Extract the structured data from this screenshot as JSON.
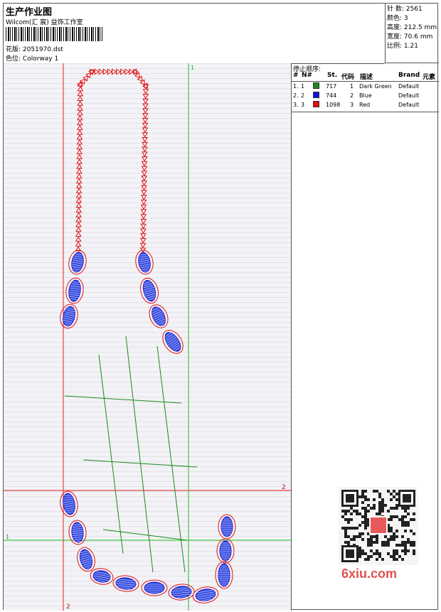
{
  "header": {
    "title": "生产作业图",
    "company": "Wilcom(汇 宸) 益饰工作室",
    "design_label": "花版:",
    "design_file": "2051970.dst",
    "colorway_label": "色位:",
    "colorway": "Colorway 1"
  },
  "stats": [
    {
      "label": "针 数:",
      "value": "2561"
    },
    {
      "label": "颜色:",
      "value": "3"
    },
    {
      "label": "高度:",
      "value": "212.5 mm"
    },
    {
      "label": "宽度:",
      "value": "70.6 mm"
    },
    {
      "label": "比例:",
      "value": "1.21"
    }
  ],
  "guides": {
    "v1": "1",
    "h2": "2",
    "h1": "1",
    "v2": "2"
  },
  "stop_sequence": {
    "title": "停止顺序:",
    "columns": [
      "#",
      "N#",
      "St.",
      "代码",
      "描述",
      "Brand",
      "元素"
    ],
    "rows": [
      {
        "num": "1.",
        "n": "1",
        "color": "#1a8a1a",
        "stitches": "717",
        "code": "1",
        "desc": "Dark Green",
        "brand": "Default"
      },
      {
        "num": "2.",
        "n": "2",
        "color": "#1010e0",
        "stitches": "744",
        "code": "2",
        "desc": "Blue",
        "brand": "Default"
      },
      {
        "num": "3.",
        "n": "3",
        "color": "#e01010",
        "stitches": "1098",
        "code": "3",
        "desc": "Red",
        "brand": "Default"
      }
    ]
  },
  "watermark": {
    "text": "6xiu.com"
  }
}
